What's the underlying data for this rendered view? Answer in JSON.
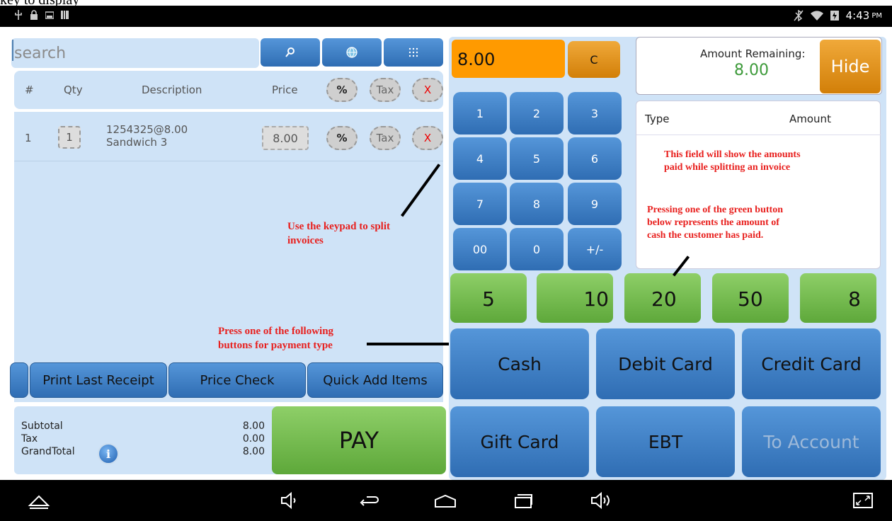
{
  "caption": "key to display",
  "status": {
    "time": "4:43",
    "ampm": "PM"
  },
  "search": {
    "placeholder": "search"
  },
  "headers": {
    "num": "#",
    "qty": "Qty",
    "desc": "Description",
    "price": "Price",
    "pct": "%",
    "tax": "Tax",
    "del": "X"
  },
  "items": [
    {
      "num": "1",
      "qty": "1",
      "line1": "1254325@8.00",
      "line2": "Sandwich 3",
      "price": "8.00",
      "pct": "%",
      "tax": "Tax",
      "del": "X"
    }
  ],
  "quick": {
    "print": "Print Last Receipt",
    "price_check": "Price Check",
    "quick_add": "Quick Add Items"
  },
  "totals": {
    "subtotal_label": "Subtotal",
    "subtotal": "8.00",
    "tax_label": "Tax",
    "tax": "0.00",
    "grand_label": "GrandTotal",
    "grand": "8.00",
    "info": "i"
  },
  "pay": "PAY",
  "keypad": {
    "display": "8.00",
    "clear": "C",
    "keys": [
      "1",
      "2",
      "3",
      "4",
      "5",
      "6",
      "7",
      "8",
      "9",
      "00",
      "0",
      "+/-"
    ]
  },
  "amount": {
    "label": "Amount Remaining:",
    "value": "8.00",
    "hide": "Hide"
  },
  "paid": {
    "type": "Type",
    "amount": "Amount"
  },
  "cash_buttons": [
    "5",
    "10",
    "20",
    "50",
    "8"
  ],
  "payment_types": [
    "Cash",
    "Debit Card",
    "Credit Card",
    "Gift Card",
    "EBT",
    "To Account"
  ],
  "annotations": {
    "keypad_1": "Use the keypad to split",
    "keypad_2": "invoices",
    "payment_1": "Press one of the following",
    "payment_2": "buttons for payment type",
    "field_1": "This field will show the amounts",
    "field_2": "paid while splitting an invoice",
    "green_1": "Pressing one of the green button",
    "green_2": "below represents the amount of",
    "green_3": "cash the customer has paid."
  },
  "colors": {
    "accent_blue": "#3a7cc4",
    "panel": "#cfe3f7",
    "green": "#6cb847",
    "orange": "#ff9a00",
    "annotation": "#e8201e"
  }
}
